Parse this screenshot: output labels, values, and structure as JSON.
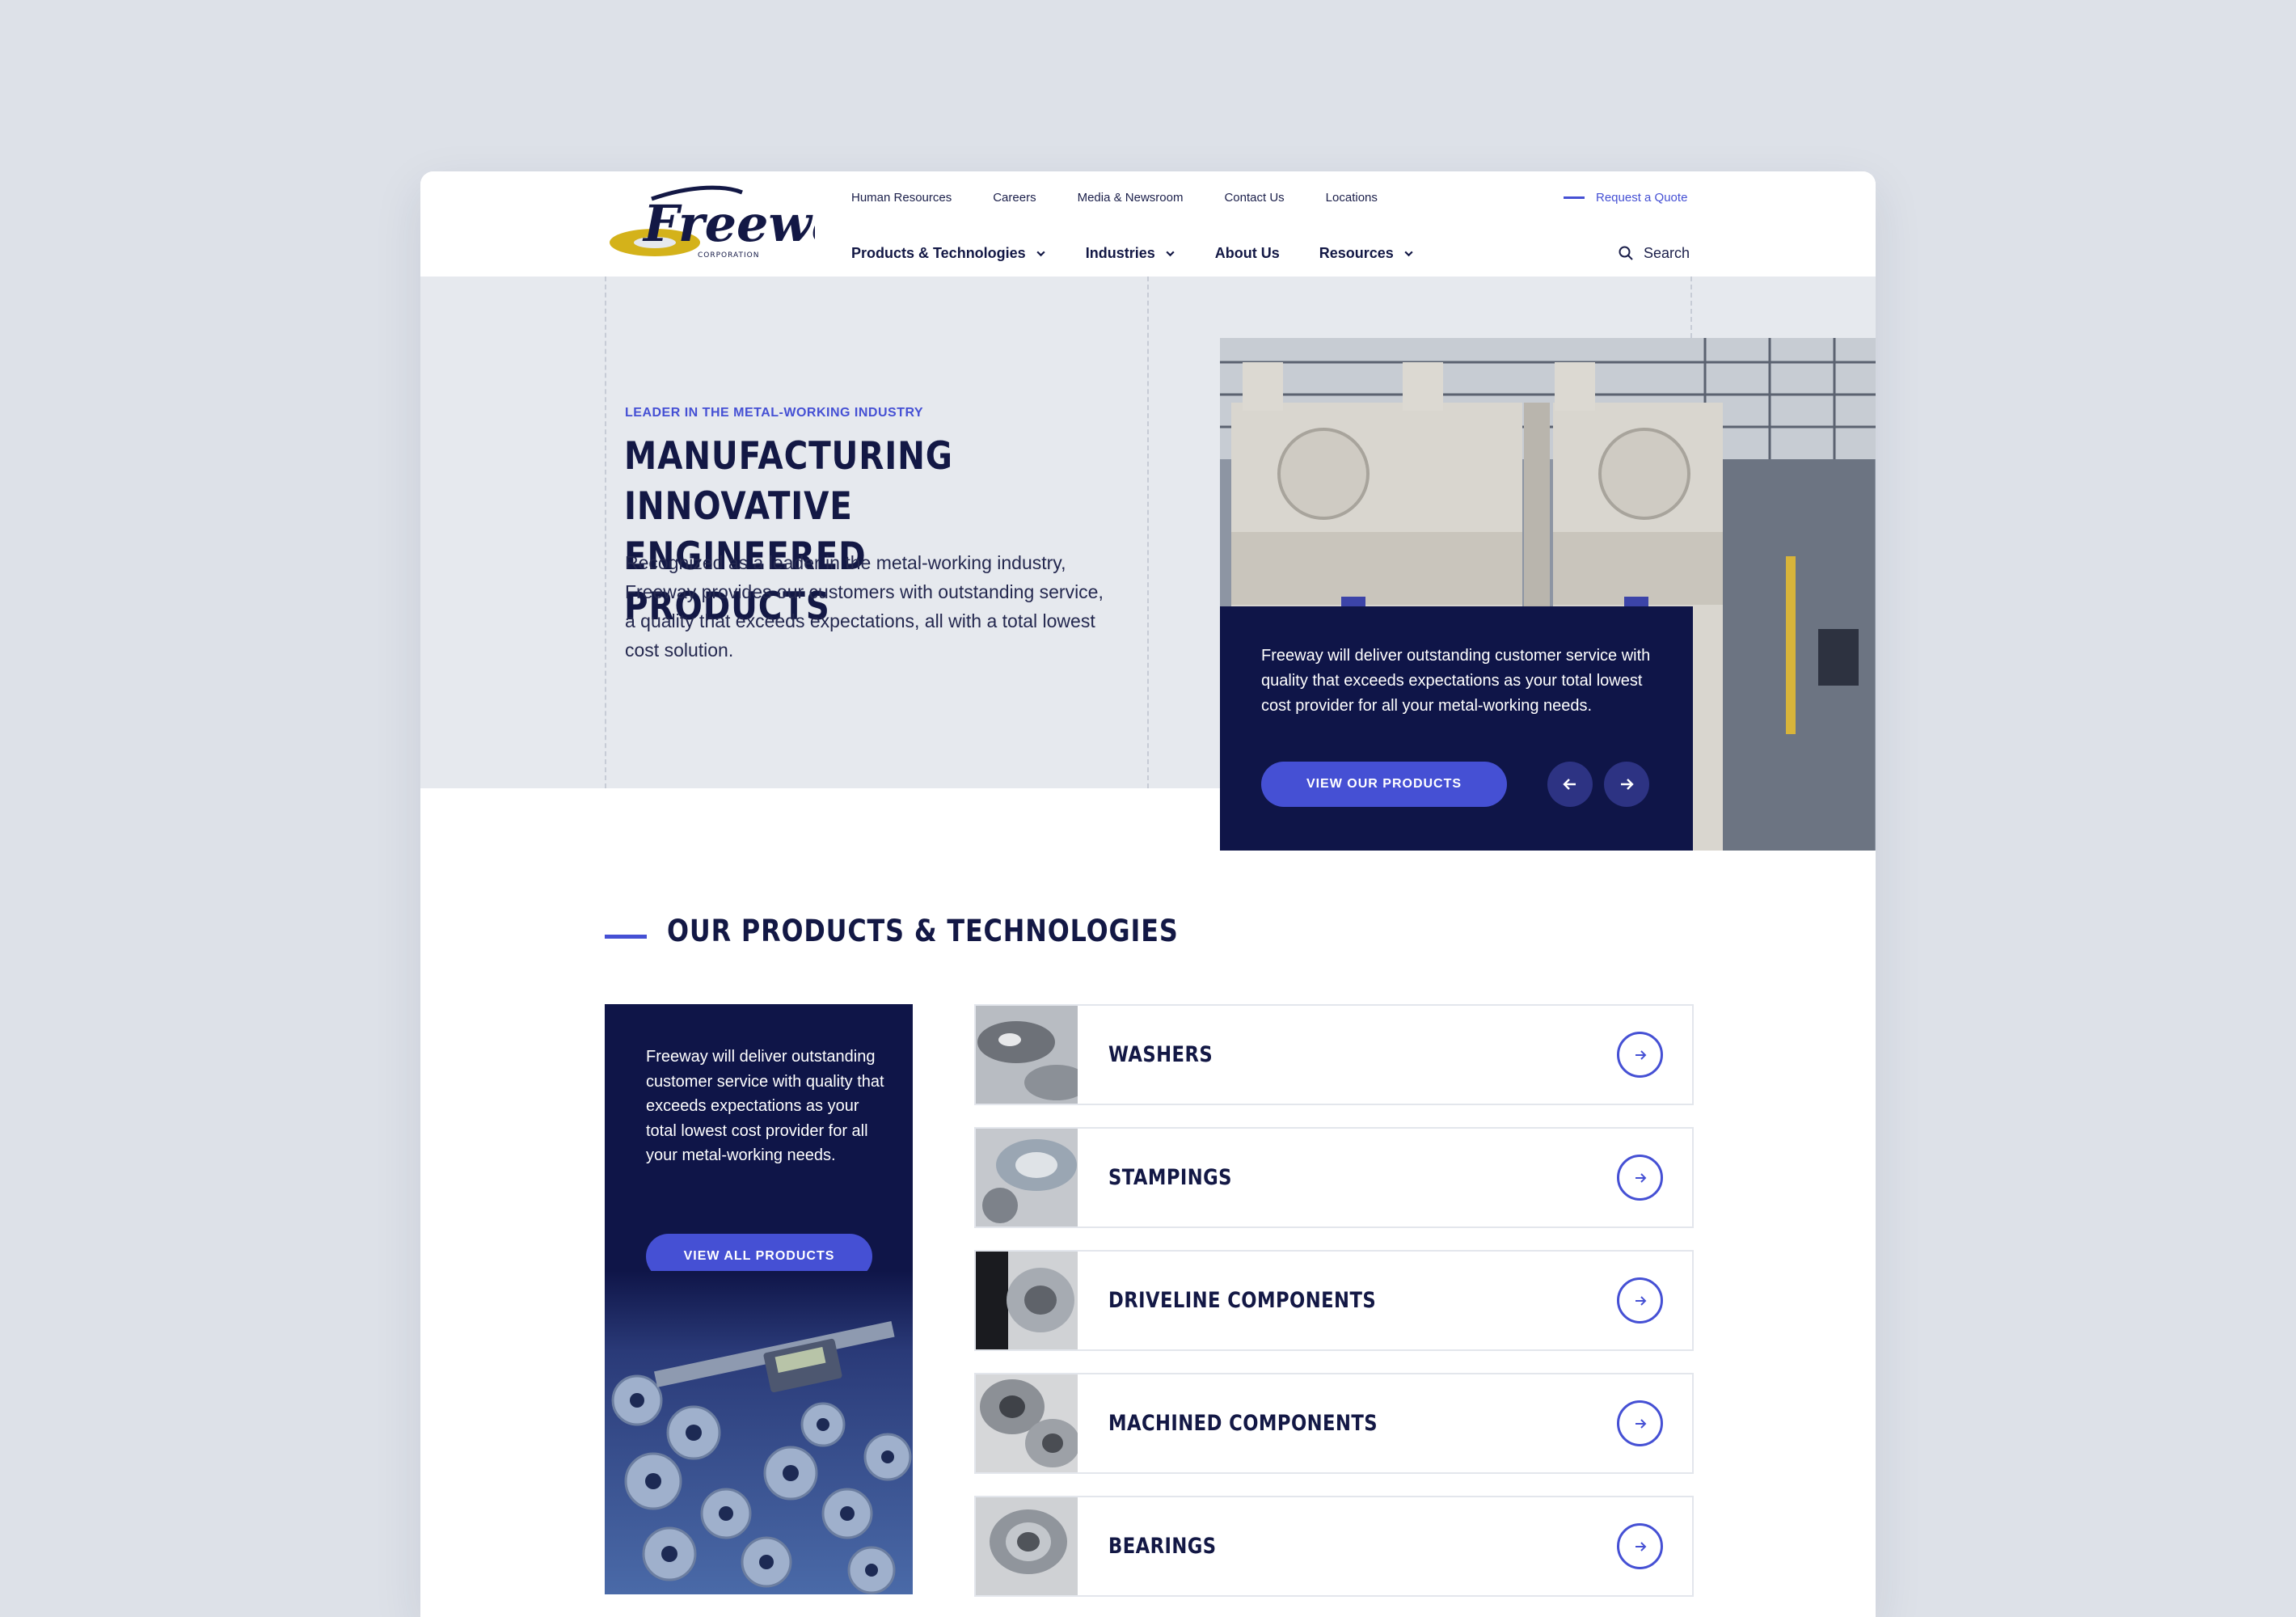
{
  "brand": {
    "logo_word": "Freeway",
    "logo_sub": "CORPORATION",
    "accent": "#4550d4",
    "navy": "#0f1548",
    "gold": "#d4b21a"
  },
  "utility_nav": [
    "Human Resources",
    "Careers",
    "Media & Newsroom",
    "Contact Us",
    "Locations"
  ],
  "quote_link": "Request a Quote",
  "main_nav": [
    {
      "label": "Products & Technologies",
      "dropdown": true
    },
    {
      "label": "Industries",
      "dropdown": true
    },
    {
      "label": "About Us",
      "dropdown": false
    },
    {
      "label": "Resources",
      "dropdown": true
    }
  ],
  "search": {
    "label": "Search",
    "icon": "search-icon"
  },
  "hero": {
    "eyebrow": "LEADER IN THE METAL-WORKING INDUSTRY",
    "title_line1": "MANUFACTURING INNOVATIVE",
    "title_line2": "ENGINEERED PRODUCTS",
    "body": "Recognized as a leader in the metal-working industry, Freeway provides our customers with outstanding service, a quality that exceeds expectations, all with a total lowest cost solution.",
    "card_text": "Freeway will deliver outstanding customer service with quality that exceeds expectations as your total lowest cost provider for all your metal-working needs.",
    "cta": "VIEW OUR PRODUCTS",
    "prev_icon": "arrow-left-icon",
    "next_icon": "arrow-right-icon"
  },
  "products": {
    "section_title": "OUR PRODUCTS & TECHNOLOGIES",
    "promo_text": "Freeway will deliver outstanding customer service with quality that exceeds expectations as your total lowest cost provider for all your metal-working needs.",
    "promo_cta": "VIEW ALL PRODUCTS",
    "items": [
      {
        "label": "WASHERS"
      },
      {
        "label": "STAMPINGS"
      },
      {
        "label": "DRIVELINE COMPONENTS"
      },
      {
        "label": "MACHINED COMPONENTS"
      },
      {
        "label": "BEARINGS"
      }
    ]
  }
}
